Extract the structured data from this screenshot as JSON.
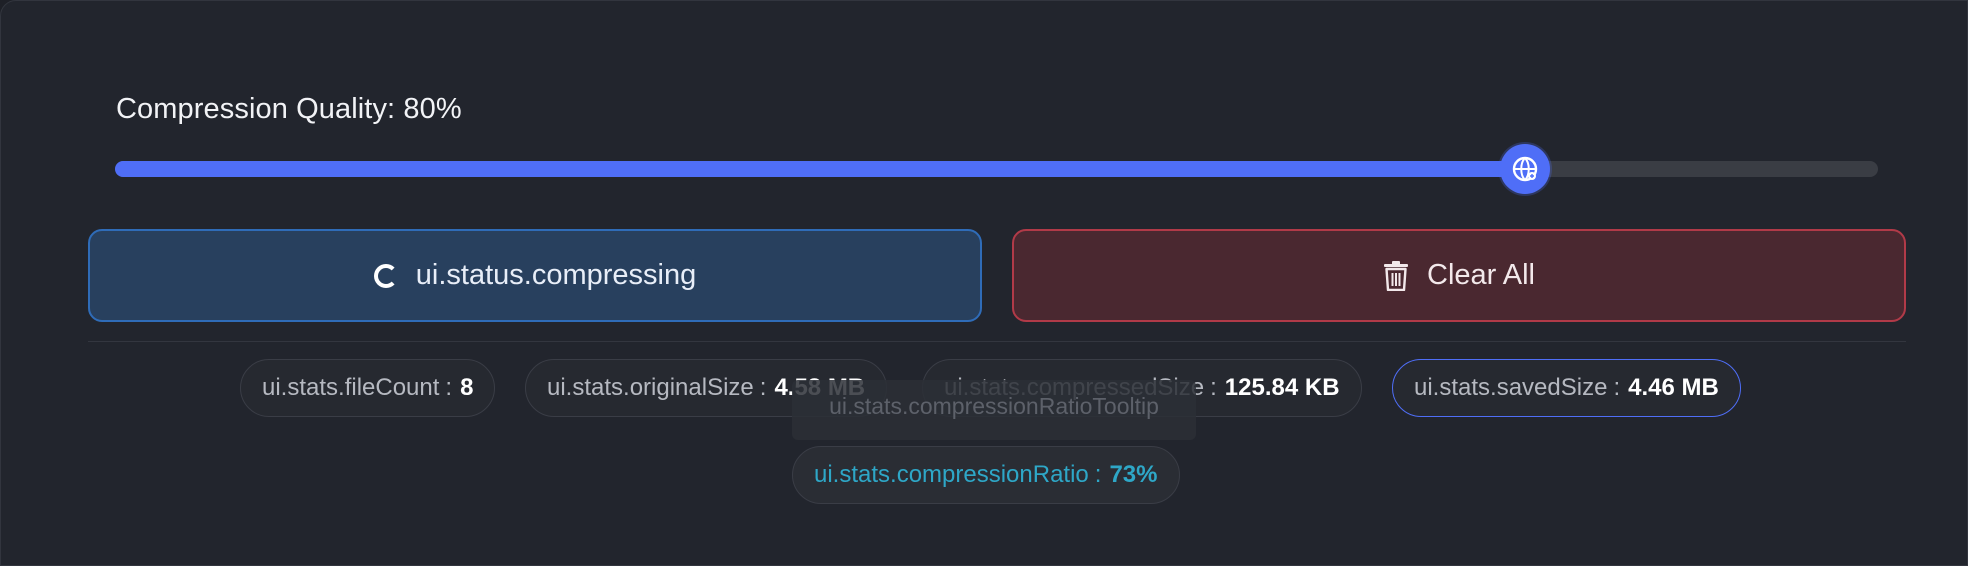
{
  "quality": {
    "label": "Compression Quality: 80%",
    "value_percent": 80
  },
  "buttons": {
    "compress_label": "ui.status.compressing",
    "clear_label": "Clear All"
  },
  "stats": {
    "file_count": {
      "key": "ui.stats.fileCount",
      "sep": ":",
      "value": "8"
    },
    "original_size": {
      "key": "ui.stats.originalSize",
      "sep": ":",
      "value": "4.58 MB"
    },
    "compressed_size": {
      "key": "ui.stats.compressedSize",
      "sep": ":",
      "value": "125.84 KB"
    },
    "saved_size": {
      "key": "ui.stats.savedSize",
      "sep": ":",
      "value": "4.46 MB"
    },
    "compression_ratio": {
      "key": "ui.stats.compressionRatio",
      "sep": ":",
      "value": "73%"
    },
    "ratio_tooltip": "ui.stats.compressionRatioTooltip"
  },
  "colors": {
    "accent": "#4f6ef7",
    "compress_border": "#2f6cb8",
    "clear_border": "#b13a48",
    "ratio_text": "#2ea7c7"
  },
  "icons": {
    "slider_thumb": "globe-icon",
    "compress": "spinner-icon",
    "clear": "trash-icon"
  }
}
